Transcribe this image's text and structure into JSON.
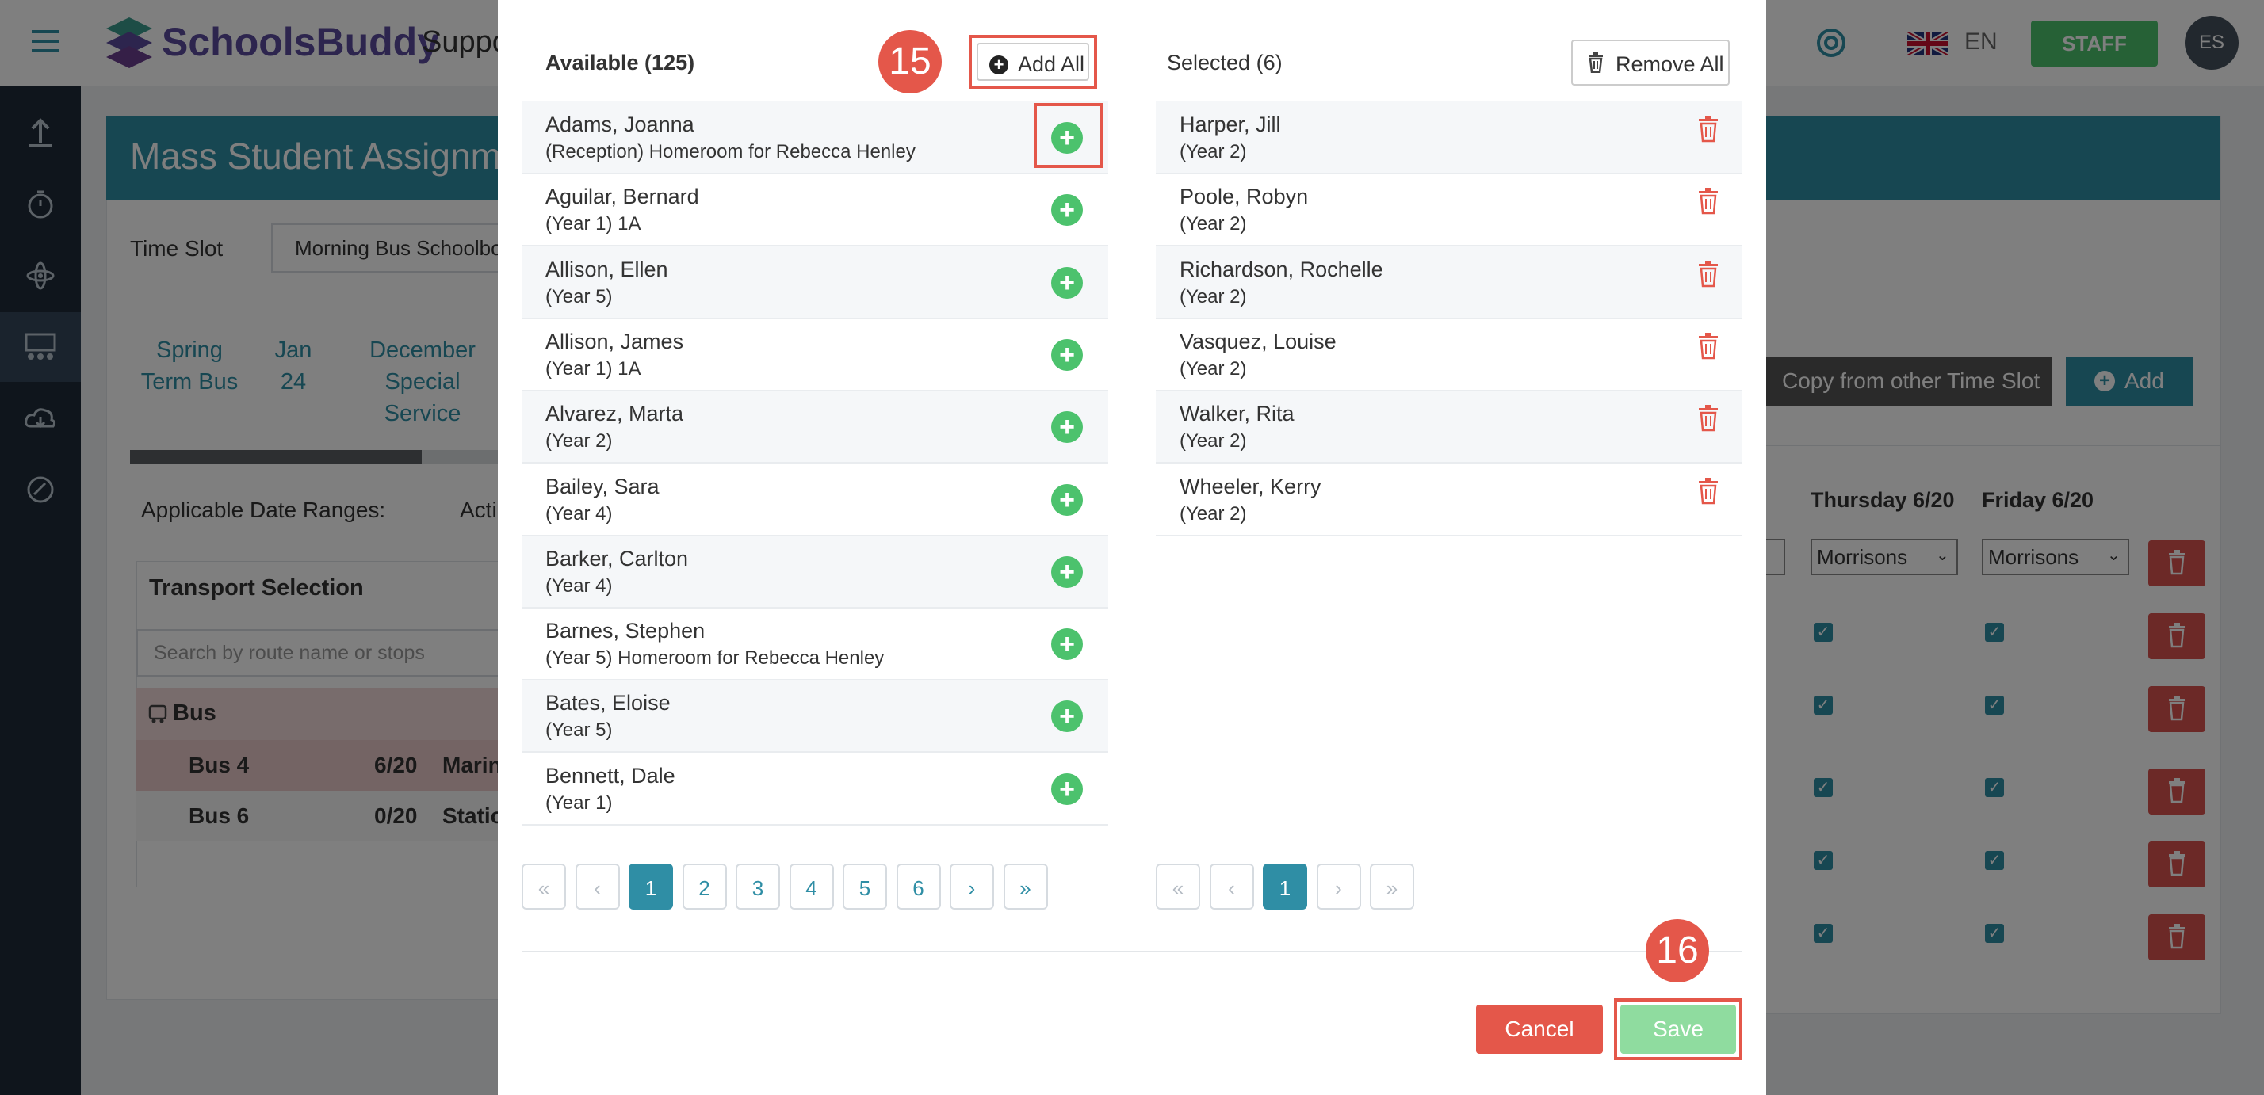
{
  "app": {
    "brand": "SchoolsBuddy",
    "section_partial": "Suppo",
    "language": "EN",
    "role_button": "STAFF",
    "avatar_initials": "ES"
  },
  "background": {
    "page_title_partial": "Mass Student Assignm",
    "time_slot_label": "Time Slot",
    "time_slot_value_partial": "Morning Bus Schoolbo",
    "tabs": [
      {
        "label": "Spring Term Bus"
      },
      {
        "label": "Jan 24"
      },
      {
        "label": "December Special Service"
      }
    ],
    "applicable_dates_label": "Applicable Date Ranges:",
    "acti_partial": "Acti",
    "transport_selection_title": "Transport Selection",
    "search_placeholder": "Search by route name or stops",
    "bus_group_label": "Bus",
    "bus_rows": [
      {
        "name": "Bus 4",
        "count": "6/20",
        "stop_partial": "Marin"
      },
      {
        "name": "Bus 6",
        "count": "0/20",
        "stop_partial": "Statio"
      }
    ],
    "copy_button": "Copy from other Time Slot",
    "add_button": "Add",
    "col_thursday": "Thursday 6/20",
    "col_friday": "Friday 6/20",
    "select_value": "Morrisons"
  },
  "modal": {
    "available_title": "Available (125)",
    "add_all_label": "Add All",
    "selected_title": "Selected (6)",
    "remove_all_label": "Remove All",
    "available": [
      {
        "name": "Adams, Joanna",
        "detail": "(Reception) Homeroom for Rebecca Henley"
      },
      {
        "name": "Aguilar, Bernard",
        "detail": "(Year 1) 1A"
      },
      {
        "name": "Allison, Ellen",
        "detail": "(Year 5)"
      },
      {
        "name": "Allison, James",
        "detail": "(Year 1) 1A"
      },
      {
        "name": "Alvarez, Marta",
        "detail": "(Year 2)"
      },
      {
        "name": "Bailey, Sara",
        "detail": "(Year 4)"
      },
      {
        "name": "Barker, Carlton",
        "detail": "(Year 4)"
      },
      {
        "name": "Barnes, Stephen",
        "detail": "(Year 5) Homeroom for Rebecca Henley"
      },
      {
        "name": "Bates, Eloise",
        "detail": "(Year 5)"
      },
      {
        "name": "Bennett, Dale",
        "detail": "(Year 1)"
      }
    ],
    "selected": [
      {
        "name": "Harper, Jill",
        "detail": "(Year 2)"
      },
      {
        "name": "Poole, Robyn",
        "detail": "(Year 2)"
      },
      {
        "name": "Richardson, Rochelle",
        "detail": "(Year 2)"
      },
      {
        "name": "Vasquez, Louise",
        "detail": "(Year 2)"
      },
      {
        "name": "Walker, Rita",
        "detail": "(Year 2)"
      },
      {
        "name": "Wheeler, Kerry",
        "detail": "(Year 2)"
      }
    ],
    "pagination_left": [
      "«",
      "‹",
      "1",
      "2",
      "3",
      "4",
      "5",
      "6",
      "›",
      "»"
    ],
    "pagination_right": [
      "«",
      "‹",
      "1",
      "›",
      "»"
    ],
    "cancel_label": "Cancel",
    "save_label": "Save"
  },
  "callouts": {
    "step_a": "15",
    "step_b": "16"
  },
  "colors": {
    "accent": "#2f8ea5",
    "green": "#4cc26d",
    "danger": "#e4574a",
    "highlight_box": "#e4574a"
  }
}
